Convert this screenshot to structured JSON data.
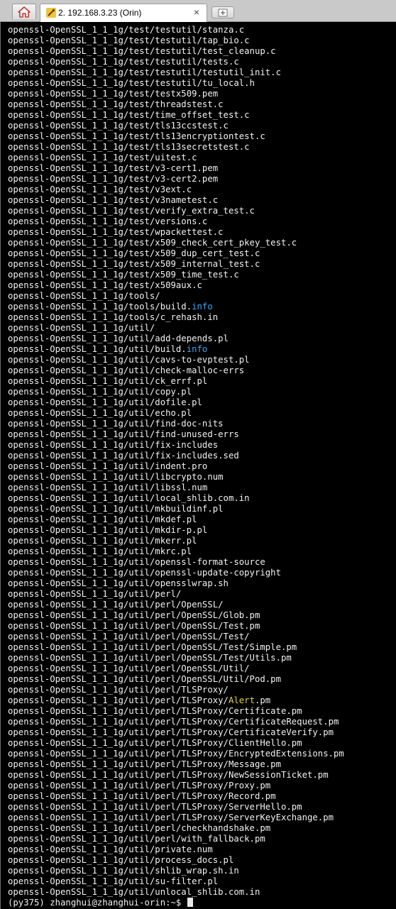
{
  "tabbar": {
    "home_icon": "home-icon",
    "tab": {
      "title": "2. 192.168.3.23 (Orin)",
      "icon": "session-icon",
      "close": "×"
    },
    "new_tab_icon": "add-tab-icon"
  },
  "terminal": {
    "lines": [
      {
        "pre": "openssl-OpenSSL_1_1_1g/test/testutil/stanza.c"
      },
      {
        "pre": "openssl-OpenSSL_1_1_1g/test/testutil/tap_bio.c"
      },
      {
        "pre": "openssl-OpenSSL_1_1_1g/test/testutil/test_cleanup.c"
      },
      {
        "pre": "openssl-OpenSSL_1_1_1g/test/testutil/tests.c"
      },
      {
        "pre": "openssl-OpenSSL_1_1_1g/test/testutil/testutil_init.c"
      },
      {
        "pre": "openssl-OpenSSL_1_1_1g/test/testutil/tu_local.h"
      },
      {
        "pre": "openssl-OpenSSL_1_1_1g/test/testx509.pem"
      },
      {
        "pre": "openssl-OpenSSL_1_1_1g/test/threadstest.c"
      },
      {
        "pre": "openssl-OpenSSL_1_1_1g/test/time_offset_test.c"
      },
      {
        "pre": "openssl-OpenSSL_1_1_1g/test/tls13ccstest.c"
      },
      {
        "pre": "openssl-OpenSSL_1_1_1g/test/tls13encryptiontest.c"
      },
      {
        "pre": "openssl-OpenSSL_1_1_1g/test/tls13secretstest.c"
      },
      {
        "pre": "openssl-OpenSSL_1_1_1g/test/uitest.c"
      },
      {
        "pre": "openssl-OpenSSL_1_1_1g/test/v3-cert1.pem"
      },
      {
        "pre": "openssl-OpenSSL_1_1_1g/test/v3-cert2.pem"
      },
      {
        "pre": "openssl-OpenSSL_1_1_1g/test/v3ext.c"
      },
      {
        "pre": "openssl-OpenSSL_1_1_1g/test/v3nametest.c"
      },
      {
        "pre": "openssl-OpenSSL_1_1_1g/test/verify_extra_test.c"
      },
      {
        "pre": "openssl-OpenSSL_1_1_1g/test/versions.c"
      },
      {
        "pre": "openssl-OpenSSL_1_1_1g/test/wpackettest.c"
      },
      {
        "pre": "openssl-OpenSSL_1_1_1g/test/x509_check_cert_pkey_test.c"
      },
      {
        "pre": "openssl-OpenSSL_1_1_1g/test/x509_dup_cert_test.c"
      },
      {
        "pre": "openssl-OpenSSL_1_1_1g/test/x509_internal_test.c"
      },
      {
        "pre": "openssl-OpenSSL_1_1_1g/test/x509_time_test.c"
      },
      {
        "pre": "openssl-OpenSSL_1_1_1g/test/x509aux.c"
      },
      {
        "pre": "openssl-OpenSSL_1_1_1g/tools/"
      },
      {
        "pre": "openssl-OpenSSL_1_1_1g/tools/build.",
        "hl": "info",
        "hl_color": "cyan"
      },
      {
        "pre": "openssl-OpenSSL_1_1_1g/tools/c_rehash.in"
      },
      {
        "pre": "openssl-OpenSSL_1_1_1g/util/"
      },
      {
        "pre": "openssl-OpenSSL_1_1_1g/util/add-depends.pl"
      },
      {
        "pre": "openssl-OpenSSL_1_1_1g/util/build.",
        "hl": "info",
        "hl_color": "cyan"
      },
      {
        "pre": "openssl-OpenSSL_1_1_1g/util/cavs-to-evptest.pl"
      },
      {
        "pre": "openssl-OpenSSL_1_1_1g/util/check-malloc-errs"
      },
      {
        "pre": "openssl-OpenSSL_1_1_1g/util/ck_errf.pl"
      },
      {
        "pre": "openssl-OpenSSL_1_1_1g/util/copy.pl"
      },
      {
        "pre": "openssl-OpenSSL_1_1_1g/util/dofile.pl"
      },
      {
        "pre": "openssl-OpenSSL_1_1_1g/util/echo.pl"
      },
      {
        "pre": "openssl-OpenSSL_1_1_1g/util/find-doc-nits"
      },
      {
        "pre": "openssl-OpenSSL_1_1_1g/util/find-unused-errs"
      },
      {
        "pre": "openssl-OpenSSL_1_1_1g/util/fix-includes"
      },
      {
        "pre": "openssl-OpenSSL_1_1_1g/util/fix-includes.sed"
      },
      {
        "pre": "openssl-OpenSSL_1_1_1g/util/indent.pro"
      },
      {
        "pre": "openssl-OpenSSL_1_1_1g/util/libcrypto.num"
      },
      {
        "pre": "openssl-OpenSSL_1_1_1g/util/libssl.num"
      },
      {
        "pre": "openssl-OpenSSL_1_1_1g/util/local_shlib.com.in"
      },
      {
        "pre": "openssl-OpenSSL_1_1_1g/util/mkbuildinf.pl"
      },
      {
        "pre": "openssl-OpenSSL_1_1_1g/util/mkdef.pl"
      },
      {
        "pre": "openssl-OpenSSL_1_1_1g/util/mkdir-p.pl"
      },
      {
        "pre": "openssl-OpenSSL_1_1_1g/util/mkerr.pl"
      },
      {
        "pre": "openssl-OpenSSL_1_1_1g/util/mkrc.pl"
      },
      {
        "pre": "openssl-OpenSSL_1_1_1g/util/openssl-format-source"
      },
      {
        "pre": "openssl-OpenSSL_1_1_1g/util/openssl-update-copyright"
      },
      {
        "pre": "openssl-OpenSSL_1_1_1g/util/opensslwrap.sh"
      },
      {
        "pre": "openssl-OpenSSL_1_1_1g/util/perl/"
      },
      {
        "pre": "openssl-OpenSSL_1_1_1g/util/perl/OpenSSL/"
      },
      {
        "pre": "openssl-OpenSSL_1_1_1g/util/perl/OpenSSL/Glob.pm"
      },
      {
        "pre": "openssl-OpenSSL_1_1_1g/util/perl/OpenSSL/Test.pm"
      },
      {
        "pre": "openssl-OpenSSL_1_1_1g/util/perl/OpenSSL/Test/"
      },
      {
        "pre": "openssl-OpenSSL_1_1_1g/util/perl/OpenSSL/Test/Simple.pm"
      },
      {
        "pre": "openssl-OpenSSL_1_1_1g/util/perl/OpenSSL/Test/Utils.pm"
      },
      {
        "pre": "openssl-OpenSSL_1_1_1g/util/perl/OpenSSL/Util/"
      },
      {
        "pre": "openssl-OpenSSL_1_1_1g/util/perl/OpenSSL/Util/Pod.pm"
      },
      {
        "pre": "openssl-OpenSSL_1_1_1g/util/perl/TLSProxy/"
      },
      {
        "pre": "openssl-OpenSSL_1_1_1g/util/perl/TLSProxy/",
        "hl": "Alert",
        "hl_color": "yellow",
        "post": ".pm"
      },
      {
        "pre": "openssl-OpenSSL_1_1_1g/util/perl/TLSProxy/Certificate.pm"
      },
      {
        "pre": "openssl-OpenSSL_1_1_1g/util/perl/TLSProxy/CertificateRequest.pm"
      },
      {
        "pre": "openssl-OpenSSL_1_1_1g/util/perl/TLSProxy/CertificateVerify.pm"
      },
      {
        "pre": "openssl-OpenSSL_1_1_1g/util/perl/TLSProxy/ClientHello.pm"
      },
      {
        "pre": "openssl-OpenSSL_1_1_1g/util/perl/TLSProxy/EncryptedExtensions.pm"
      },
      {
        "pre": "openssl-OpenSSL_1_1_1g/util/perl/TLSProxy/Message.pm"
      },
      {
        "pre": "openssl-OpenSSL_1_1_1g/util/perl/TLSProxy/NewSessionTicket.pm"
      },
      {
        "pre": "openssl-OpenSSL_1_1_1g/util/perl/TLSProxy/Proxy.pm"
      },
      {
        "pre": "openssl-OpenSSL_1_1_1g/util/perl/TLSProxy/Record.pm"
      },
      {
        "pre": "openssl-OpenSSL_1_1_1g/util/perl/TLSProxy/ServerHello.pm"
      },
      {
        "pre": "openssl-OpenSSL_1_1_1g/util/perl/TLSProxy/ServerKeyExchange.pm"
      },
      {
        "pre": "openssl-OpenSSL_1_1_1g/util/perl/checkhandshake.pm"
      },
      {
        "pre": "openssl-OpenSSL_1_1_1g/util/perl/with_fallback.pm"
      },
      {
        "pre": "openssl-OpenSSL_1_1_1g/util/private.num"
      },
      {
        "pre": "openssl-OpenSSL_1_1_1g/util/process_docs.pl"
      },
      {
        "pre": "openssl-OpenSSL_1_1_1g/util/shlib_wrap.sh.in"
      },
      {
        "pre": "openssl-OpenSSL_1_1_1g/util/su-filter.pl"
      },
      {
        "pre": "openssl-OpenSSL_1_1_1g/util/unlocal_shlib.com.in"
      }
    ],
    "prompt": "(py375) zhanghui@zhanghui-orin:~$ "
  },
  "colors": {
    "cyan": "#3ba7f0",
    "yellow": "#e4d23a",
    "text": "#f2f2f2",
    "background": "#000000"
  }
}
